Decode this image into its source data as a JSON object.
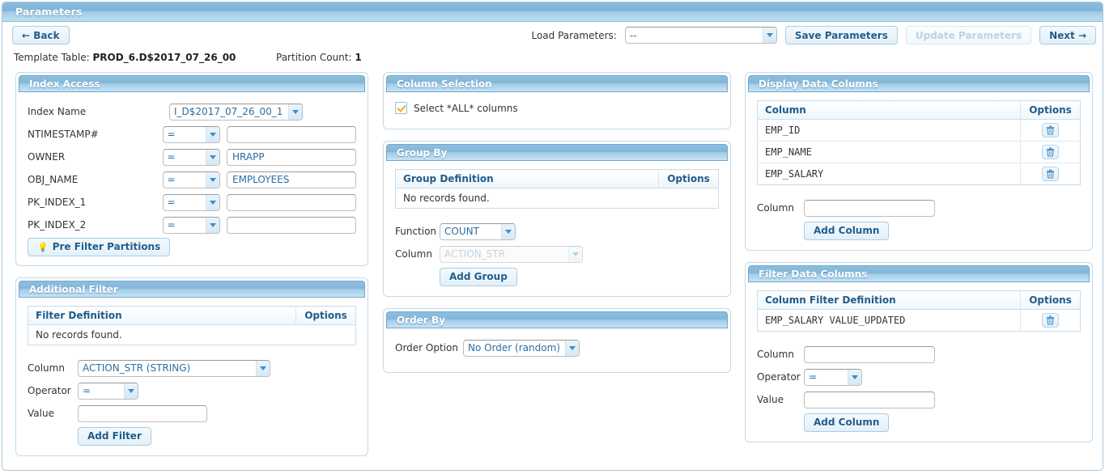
{
  "window": {
    "title": "Parameters"
  },
  "toolbar": {
    "back_label": "← Back",
    "load_params_label": "Load Parameters:",
    "load_params_value": "--",
    "save_params_label": "Save Parameters",
    "update_params_label": "Update Parameters",
    "next_label": "Next →"
  },
  "info": {
    "template_table_label": "Template Table:",
    "template_table_value": "PROD_6.D$2017_07_26_00",
    "partition_count_label": "Partition Count:",
    "partition_count_value": "1"
  },
  "index_access": {
    "title": "Index Access",
    "index_name_label": "Index Name",
    "index_name_value": "I_D$2017_07_26_00_1",
    "rows": [
      {
        "label": "NTIMESTAMP#",
        "operator": "=",
        "value": ""
      },
      {
        "label": "OWNER",
        "operator": "=",
        "value": "HRAPP"
      },
      {
        "label": "OBJ_NAME",
        "operator": "=",
        "value": "EMPLOYEES"
      },
      {
        "label": "PK_INDEX_1",
        "operator": "=",
        "value": ""
      },
      {
        "label": "PK_INDEX_2",
        "operator": "=",
        "value": ""
      }
    ],
    "pre_filter_label": "Pre Filter Partitions"
  },
  "additional_filter": {
    "title": "Additional Filter",
    "table": {
      "headers": [
        "Filter Definition",
        "Options"
      ],
      "empty_text": "No records found.",
      "rows": []
    },
    "column_label": "Column",
    "column_value": "ACTION_STR (STRING)",
    "operator_label": "Operator",
    "operator_value": "=",
    "value_label": "Value",
    "value_value": "",
    "add_filter_label": "Add Filter"
  },
  "column_selection": {
    "title": "Column Selection",
    "select_all_label": "Select *ALL* columns",
    "select_all_checked": true
  },
  "group_by": {
    "title": "Group By",
    "table": {
      "headers": [
        "Group Definition",
        "Options"
      ],
      "empty_text": "No records found.",
      "rows": []
    },
    "function_label": "Function",
    "function_value": "COUNT",
    "column_label": "Column",
    "column_value": "ACTION_STR",
    "column_disabled": true,
    "add_group_label": "Add Group"
  },
  "order_by": {
    "title": "Order By",
    "order_option_label": "Order Option",
    "order_option_value": "No Order (random)"
  },
  "display_data_columns": {
    "title": "Display Data Columns",
    "table": {
      "headers": [
        "Column",
        "Options"
      ],
      "rows": [
        "EMP_ID",
        "EMP_NAME",
        "EMP_SALARY"
      ]
    },
    "column_label": "Column",
    "column_value": "",
    "add_column_label": "Add Column"
  },
  "filter_data_columns": {
    "title": "Filter Data Columns",
    "table": {
      "headers": [
        "Column Filter Definition",
        "Options"
      ],
      "rows": [
        "EMP_SALARY  VALUE_UPDATED"
      ]
    },
    "column_label": "Column",
    "column_value": "",
    "operator_label": "Operator",
    "operator_value": "=",
    "value_label": "Value",
    "value_value": "",
    "add_column_label": "Add Column"
  },
  "colors": {
    "accent": "#81b6d9",
    "panel_border": "#c3daea",
    "text_blue": "#1f5c8b",
    "check_orange": "#f0a81e"
  }
}
